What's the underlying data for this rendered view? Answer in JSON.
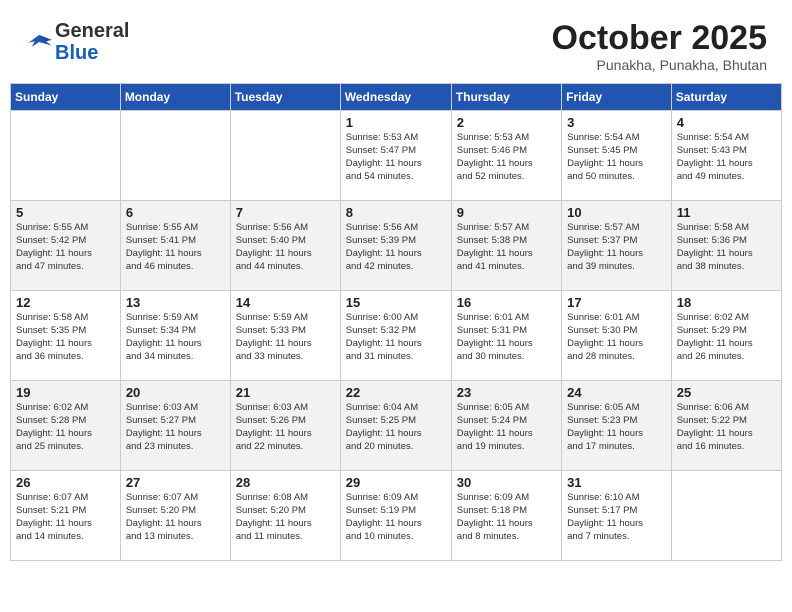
{
  "header": {
    "logo_line1": "General",
    "logo_line2": "Blue",
    "month": "October 2025",
    "location": "Punakha, Punakha, Bhutan"
  },
  "weekdays": [
    "Sunday",
    "Monday",
    "Tuesday",
    "Wednesday",
    "Thursday",
    "Friday",
    "Saturday"
  ],
  "weeks": [
    [
      {
        "day": "",
        "info": ""
      },
      {
        "day": "",
        "info": ""
      },
      {
        "day": "",
        "info": ""
      },
      {
        "day": "1",
        "info": "Sunrise: 5:53 AM\nSunset: 5:47 PM\nDaylight: 11 hours\nand 54 minutes."
      },
      {
        "day": "2",
        "info": "Sunrise: 5:53 AM\nSunset: 5:46 PM\nDaylight: 11 hours\nand 52 minutes."
      },
      {
        "day": "3",
        "info": "Sunrise: 5:54 AM\nSunset: 5:45 PM\nDaylight: 11 hours\nand 50 minutes."
      },
      {
        "day": "4",
        "info": "Sunrise: 5:54 AM\nSunset: 5:43 PM\nDaylight: 11 hours\nand 49 minutes."
      }
    ],
    [
      {
        "day": "5",
        "info": "Sunrise: 5:55 AM\nSunset: 5:42 PM\nDaylight: 11 hours\nand 47 minutes."
      },
      {
        "day": "6",
        "info": "Sunrise: 5:55 AM\nSunset: 5:41 PM\nDaylight: 11 hours\nand 46 minutes."
      },
      {
        "day": "7",
        "info": "Sunrise: 5:56 AM\nSunset: 5:40 PM\nDaylight: 11 hours\nand 44 minutes."
      },
      {
        "day": "8",
        "info": "Sunrise: 5:56 AM\nSunset: 5:39 PM\nDaylight: 11 hours\nand 42 minutes."
      },
      {
        "day": "9",
        "info": "Sunrise: 5:57 AM\nSunset: 5:38 PM\nDaylight: 11 hours\nand 41 minutes."
      },
      {
        "day": "10",
        "info": "Sunrise: 5:57 AM\nSunset: 5:37 PM\nDaylight: 11 hours\nand 39 minutes."
      },
      {
        "day": "11",
        "info": "Sunrise: 5:58 AM\nSunset: 5:36 PM\nDaylight: 11 hours\nand 38 minutes."
      }
    ],
    [
      {
        "day": "12",
        "info": "Sunrise: 5:58 AM\nSunset: 5:35 PM\nDaylight: 11 hours\nand 36 minutes."
      },
      {
        "day": "13",
        "info": "Sunrise: 5:59 AM\nSunset: 5:34 PM\nDaylight: 11 hours\nand 34 minutes."
      },
      {
        "day": "14",
        "info": "Sunrise: 5:59 AM\nSunset: 5:33 PM\nDaylight: 11 hours\nand 33 minutes."
      },
      {
        "day": "15",
        "info": "Sunrise: 6:00 AM\nSunset: 5:32 PM\nDaylight: 11 hours\nand 31 minutes."
      },
      {
        "day": "16",
        "info": "Sunrise: 6:01 AM\nSunset: 5:31 PM\nDaylight: 11 hours\nand 30 minutes."
      },
      {
        "day": "17",
        "info": "Sunrise: 6:01 AM\nSunset: 5:30 PM\nDaylight: 11 hours\nand 28 minutes."
      },
      {
        "day": "18",
        "info": "Sunrise: 6:02 AM\nSunset: 5:29 PM\nDaylight: 11 hours\nand 26 minutes."
      }
    ],
    [
      {
        "day": "19",
        "info": "Sunrise: 6:02 AM\nSunset: 5:28 PM\nDaylight: 11 hours\nand 25 minutes."
      },
      {
        "day": "20",
        "info": "Sunrise: 6:03 AM\nSunset: 5:27 PM\nDaylight: 11 hours\nand 23 minutes."
      },
      {
        "day": "21",
        "info": "Sunrise: 6:03 AM\nSunset: 5:26 PM\nDaylight: 11 hours\nand 22 minutes."
      },
      {
        "day": "22",
        "info": "Sunrise: 6:04 AM\nSunset: 5:25 PM\nDaylight: 11 hours\nand 20 minutes."
      },
      {
        "day": "23",
        "info": "Sunrise: 6:05 AM\nSunset: 5:24 PM\nDaylight: 11 hours\nand 19 minutes."
      },
      {
        "day": "24",
        "info": "Sunrise: 6:05 AM\nSunset: 5:23 PM\nDaylight: 11 hours\nand 17 minutes."
      },
      {
        "day": "25",
        "info": "Sunrise: 6:06 AM\nSunset: 5:22 PM\nDaylight: 11 hours\nand 16 minutes."
      }
    ],
    [
      {
        "day": "26",
        "info": "Sunrise: 6:07 AM\nSunset: 5:21 PM\nDaylight: 11 hours\nand 14 minutes."
      },
      {
        "day": "27",
        "info": "Sunrise: 6:07 AM\nSunset: 5:20 PM\nDaylight: 11 hours\nand 13 minutes."
      },
      {
        "day": "28",
        "info": "Sunrise: 6:08 AM\nSunset: 5:20 PM\nDaylight: 11 hours\nand 11 minutes."
      },
      {
        "day": "29",
        "info": "Sunrise: 6:09 AM\nSunset: 5:19 PM\nDaylight: 11 hours\nand 10 minutes."
      },
      {
        "day": "30",
        "info": "Sunrise: 6:09 AM\nSunset: 5:18 PM\nDaylight: 11 hours\nand 8 minutes."
      },
      {
        "day": "31",
        "info": "Sunrise: 6:10 AM\nSunset: 5:17 PM\nDaylight: 11 hours\nand 7 minutes."
      },
      {
        "day": "",
        "info": ""
      }
    ]
  ]
}
